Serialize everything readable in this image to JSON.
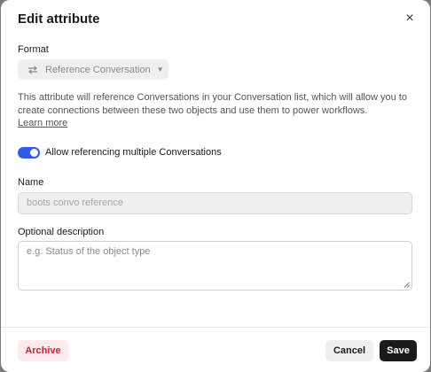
{
  "dialog": {
    "title": "Edit attribute",
    "close_icon": "close-icon"
  },
  "format": {
    "label": "Format",
    "selected": "Reference Conversation",
    "icon": "swap-arrows-icon"
  },
  "description_text": "This attribute will reference Conversations in your Conversation list, which will allow you to create connections between these two objects and use them to power workflows.",
  "learn_more": "Learn more",
  "multiple_toggle": {
    "label": "Allow referencing multiple Conversations",
    "on": true,
    "color": "#2f5de8"
  },
  "name_field": {
    "label": "Name",
    "value": "boots convo reference"
  },
  "optional_description": {
    "label": "Optional description",
    "placeholder": "e.g. Status of the object type"
  },
  "footer": {
    "archive_label": "Archive",
    "cancel_label": "Cancel",
    "save_label": "Save"
  },
  "colors": {
    "archive_text": "#c8243c",
    "save_bg": "#1a1a1a"
  }
}
